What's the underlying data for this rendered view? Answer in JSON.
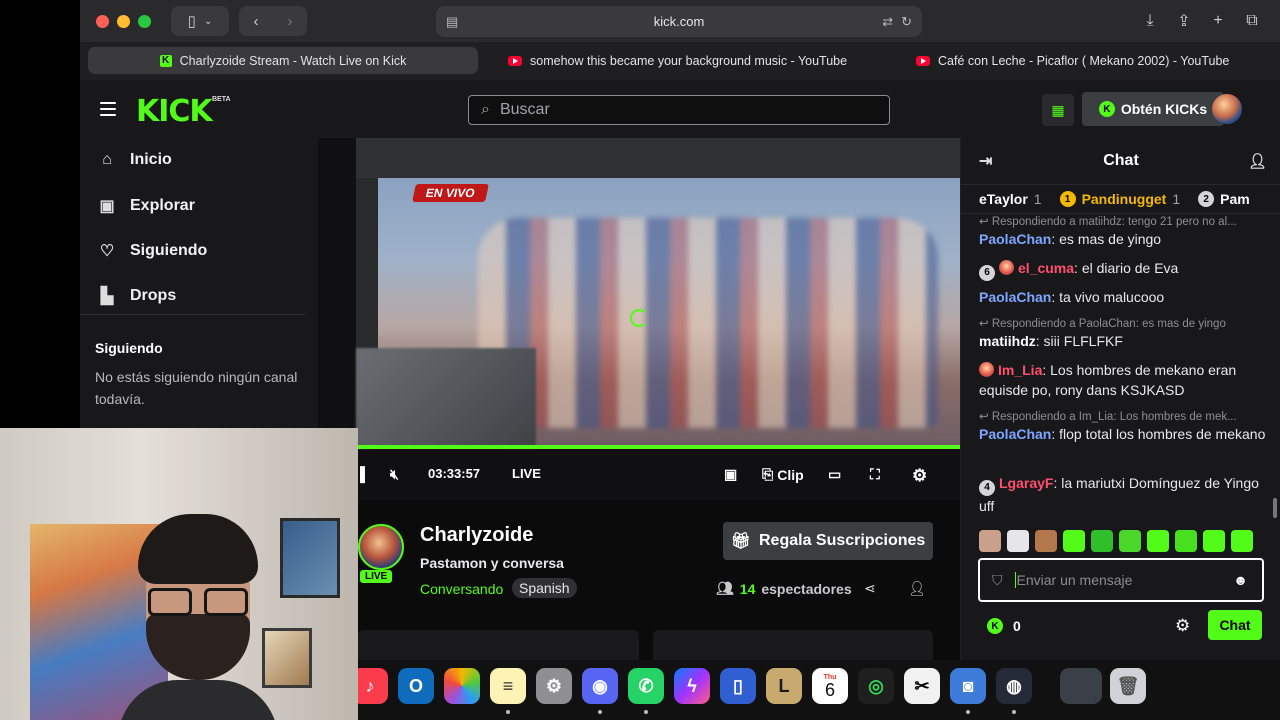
{
  "browser": {
    "url": "kick.com",
    "tabs": [
      {
        "label": "Charlyzoide Stream - Watch Live on Kick",
        "active": true
      },
      {
        "label": "somehow this became your background music - YouTube",
        "active": false
      },
      {
        "label": "Café con Leche - Picaflor ( Mekano 2002) - YouTube",
        "active": false
      }
    ]
  },
  "header": {
    "logo": "KICK",
    "beta": "BETA",
    "search_placeholder": "Buscar",
    "get_kicks_label": "Obtén KICKs"
  },
  "sidebar": {
    "items": [
      {
        "label": "Inicio",
        "icon": "home-icon"
      },
      {
        "label": "Explorar",
        "icon": "compass-icon"
      },
      {
        "label": "Siguiendo",
        "icon": "heart-icon"
      },
      {
        "label": "Drops",
        "icon": "drops-icon"
      }
    ],
    "following_heading": "Siguiendo",
    "following_empty": "No estás siguiendo ningún canal todavía."
  },
  "player": {
    "overlay_text": "EN VIVO",
    "time": "03:33:57",
    "live_label": "LIVE",
    "clip_label": "Clip"
  },
  "stream": {
    "channel": "Charlyzoide",
    "live_badge": "LIVE",
    "title": "Pastamon y conversa",
    "category": "Conversando",
    "language": "Spanish",
    "gift_label": "Regala Suscripciones",
    "viewers": "14",
    "viewers_label": "espectadores"
  },
  "chat": {
    "title": "Chat",
    "gifters": [
      {
        "name": "eTaylor",
        "count": "1",
        "rank": ""
      },
      {
        "name": "Pandinugget",
        "count": "1",
        "rank": "1"
      },
      {
        "name": "Pam",
        "count": "",
        "rank": "2"
      }
    ],
    "messages": [
      {
        "type": "reply",
        "text": "Respondiendo a matiihdz: tengo 21 pero no al..."
      },
      {
        "type": "msg",
        "user": "PaolaChan",
        "color": "#7ea6ff",
        "text": ": es mas de yingo"
      },
      {
        "type": "msg",
        "badge": "6",
        "emote": true,
        "user": "el_cuma",
        "color": "#ff4f6d",
        "text": ": el diario de Eva"
      },
      {
        "type": "msg",
        "user": "PaolaChan",
        "color": "#7ea6ff",
        "text": ": ta vivo malucooo"
      },
      {
        "type": "reply",
        "text": "Respondiendo a PaolaChan: es mas de yingo"
      },
      {
        "type": "msg",
        "user": "matiihdz",
        "color": "#ffffff",
        "text": ": siii FLFLFKF"
      },
      {
        "type": "msg",
        "emote": true,
        "user": "Im_Lia",
        "color": "#ff4f6d",
        "text": ": Los hombres de mekano eran equisde po, rony dans KSJKASD"
      },
      {
        "type": "reply",
        "text": "Respondiendo a Im_Lia: Los hombres de mek..."
      },
      {
        "type": "msg",
        "user": "PaolaChan",
        "color": "#7ea6ff",
        "text": ": flop total los hombres de mekano"
      },
      {
        "type": "msg",
        "badge": "4",
        "user": "LgarayF",
        "color": "#ff4f6d",
        "text": ": la mariutxi Domínguez de Yingo uff"
      }
    ],
    "input_placeholder": "Enviar un mensaje",
    "kicks_count": "0",
    "send_label": "Chat"
  },
  "dock": {
    "calendar_day": "Thu",
    "calendar_date": "6"
  },
  "colors": {
    "accent": "#53fc18",
    "bg": "#0b0b0c",
    "panel": "#18181b"
  }
}
